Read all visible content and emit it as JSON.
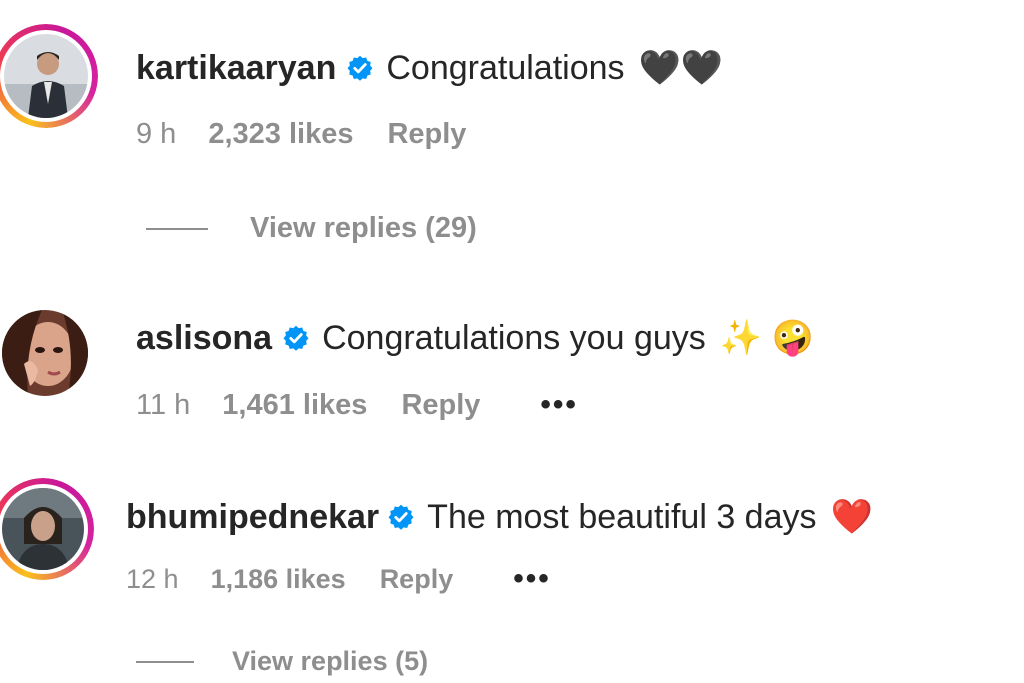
{
  "comments": [
    {
      "username": "kartikaaryan",
      "text": "Congratulations",
      "emoji": "🖤🖤",
      "time": "9 h",
      "likes": "2,323 likes",
      "reply": "Reply",
      "view_replies": "View replies (29)"
    },
    {
      "username": "aslisona",
      "text": "Congratulations you guys",
      "emoji": "✨ 🤪",
      "time": "11 h",
      "likes": "1,461 likes",
      "reply": "Reply",
      "more": "•••"
    },
    {
      "username": "bhumipednekar",
      "text": "The most beautiful 3 days",
      "emoji": "❤️",
      "time": "12 h",
      "likes": "1,186 likes",
      "reply": "Reply",
      "more": "•••",
      "view_replies": "View replies (5)"
    }
  ],
  "colors": {
    "verified": "#0095f6",
    "meta_text": "#8e8e8e",
    "main_text": "#262626"
  }
}
